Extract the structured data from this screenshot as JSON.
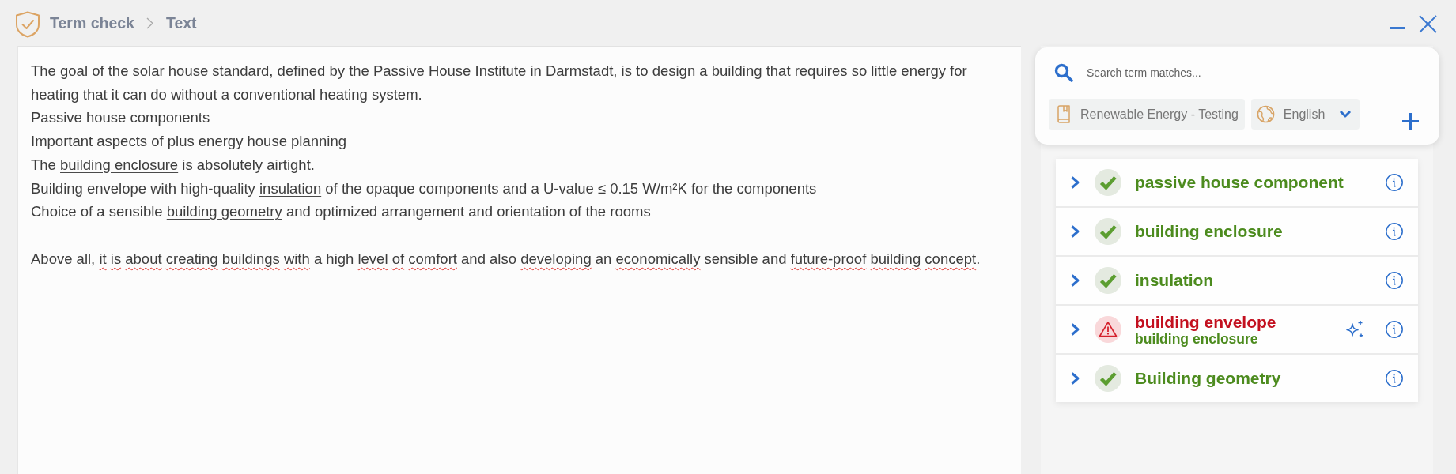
{
  "breadcrumb": [
    "Term check",
    "Text"
  ],
  "editor": {
    "paragraphs": [
      {
        "lines": [
          {
            "segments": [
              {
                "kind": "plain",
                "text": "The goal of the solar house standard, defined by the Passive House Institute in Darmstadt, is to design a building that requires so little energy for heating that it can do without a conventional heating system."
              }
            ]
          },
          {
            "segments": [
              {
                "kind": "plain",
                "text": "Passive house components"
              }
            ]
          },
          {
            "segments": [
              {
                "kind": "plain",
                "text": "Important aspects of plus energy house planning"
              }
            ]
          },
          {
            "segments": [
              {
                "kind": "plain",
                "text": "The "
              },
              {
                "kind": "term",
                "text": "building enclosure"
              },
              {
                "kind": "plain",
                "text": " is absolutely airtight."
              }
            ]
          },
          {
            "segments": [
              {
                "kind": "plain",
                "text": "Building envelope with high-quality "
              },
              {
                "kind": "term",
                "text": "insulation"
              },
              {
                "kind": "plain",
                "text": " of the opaque components and a U-value ≤ 0.15 W/m²K for the components"
              }
            ]
          },
          {
            "segments": [
              {
                "kind": "plain",
                "text": "Choice of a sensible "
              },
              {
                "kind": "term",
                "text": "building geometry"
              },
              {
                "kind": "plain",
                "text": " and optimized arrangement and orientation of the rooms"
              }
            ]
          }
        ]
      },
      {
        "lines": [
          {
            "segments": [
              {
                "kind": "plain",
                "text": "Above all, "
              },
              {
                "kind": "spelling",
                "words": [
                  "it",
                  "is",
                  "about",
                  "creating",
                  "buildings",
                  "with"
                ]
              },
              {
                "kind": "plain",
                "text": " a high "
              },
              {
                "kind": "spelling",
                "words": [
                  "level",
                  "of",
                  "comfort"
                ]
              },
              {
                "kind": "plain",
                "text": " and also "
              },
              {
                "kind": "spelling",
                "words": [
                  "developing"
                ]
              },
              {
                "kind": "plain",
                "text": " an "
              },
              {
                "kind": "spelling",
                "words": [
                  "economically"
                ]
              },
              {
                "kind": "plain",
                "text": " sensible and "
              },
              {
                "kind": "spelling",
                "words": [
                  "future-proof",
                  "building",
                  "concept"
                ]
              },
              {
                "kind": "plain",
                "text": "."
              }
            ]
          }
        ]
      }
    ]
  },
  "search": {
    "placeholder": "Search term matches..."
  },
  "filters": [
    {
      "kind": "glossary",
      "label": "Renewable Energy - Testing"
    },
    {
      "kind": "language",
      "label": "English"
    }
  ],
  "matches": [
    {
      "kind": "approved",
      "term": "passive house component",
      "expanded": false
    },
    {
      "kind": "approved",
      "term": "building enclosure",
      "expanded": false
    },
    {
      "kind": "approved",
      "term": "insulation",
      "expanded": false
    },
    {
      "kind": "forbidden",
      "term": "building envelope",
      "suggestion": "building enclosure",
      "expanded": false
    },
    {
      "kind": "approved",
      "term": "Building geometry",
      "expanded": false
    }
  ]
}
